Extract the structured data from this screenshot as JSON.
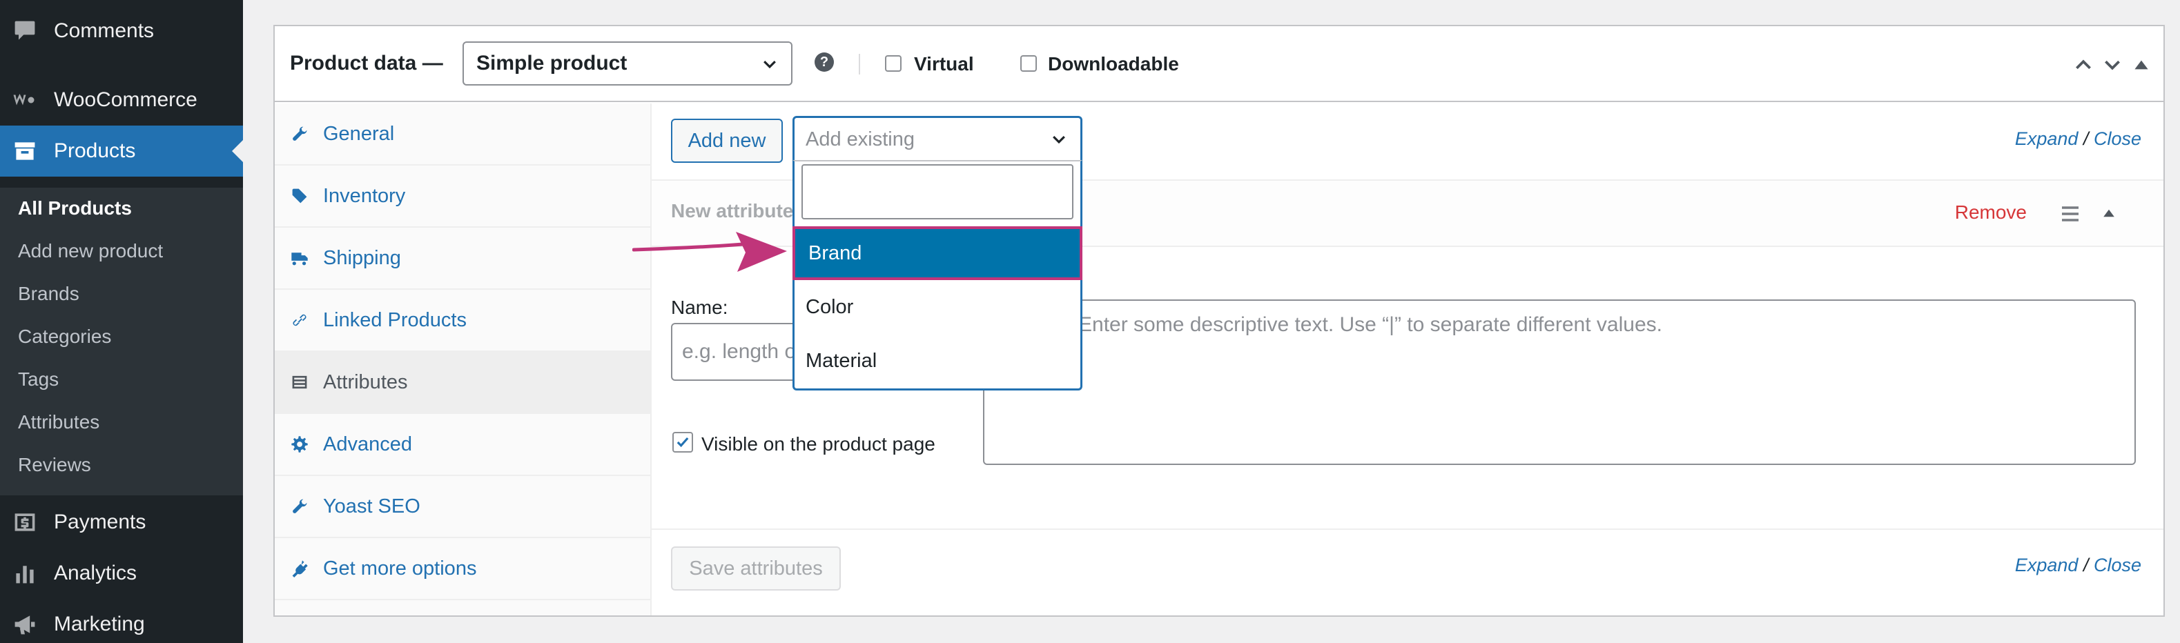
{
  "sidebar": {
    "items": {
      "comments": "Comments",
      "woocommerce": "WooCommerce",
      "products": "Products",
      "payments": "Payments",
      "analytics": "Analytics",
      "marketing": "Marketing"
    },
    "submenu": [
      "All Products",
      "Add new product",
      "Brands",
      "Categories",
      "Tags",
      "Attributes",
      "Reviews"
    ],
    "colors": {
      "background": "#1d2327",
      "submenu": "#2c3338",
      "current": "#2271b1"
    }
  },
  "product_data": {
    "title": "Product data —",
    "product_type": "Simple product",
    "help_icon": "?",
    "virtual_label": "Virtual",
    "downloadable_label": "Downloadable"
  },
  "tabs": [
    "General",
    "Inventory",
    "Shipping",
    "Linked Products",
    "Attributes",
    "Advanced",
    "Yoast SEO",
    "Get more options"
  ],
  "attributes_panel": {
    "add_new_label": "Add new",
    "add_existing_placeholder": "Add existing",
    "expand_label": "Expand",
    "slash": "/",
    "close_label": "Close",
    "new_attribute_label": "New attribute",
    "remove_label": "Remove",
    "name_label": "Name:",
    "name_placeholder": "e.g. length or weight",
    "values_placeholder": "Enter some descriptive text. Use “|” to separate different values.",
    "visible_label": "Visible on the product page",
    "visible_checked": true,
    "save_label": "Save attributes"
  },
  "dropdown": {
    "options": [
      "Brand",
      "Color",
      "Material"
    ],
    "highlighted": "Brand",
    "highlight_color": "#0073aa",
    "outline_color": "#c0357a"
  },
  "annotation": {
    "arrow_color": "#c0357a"
  }
}
